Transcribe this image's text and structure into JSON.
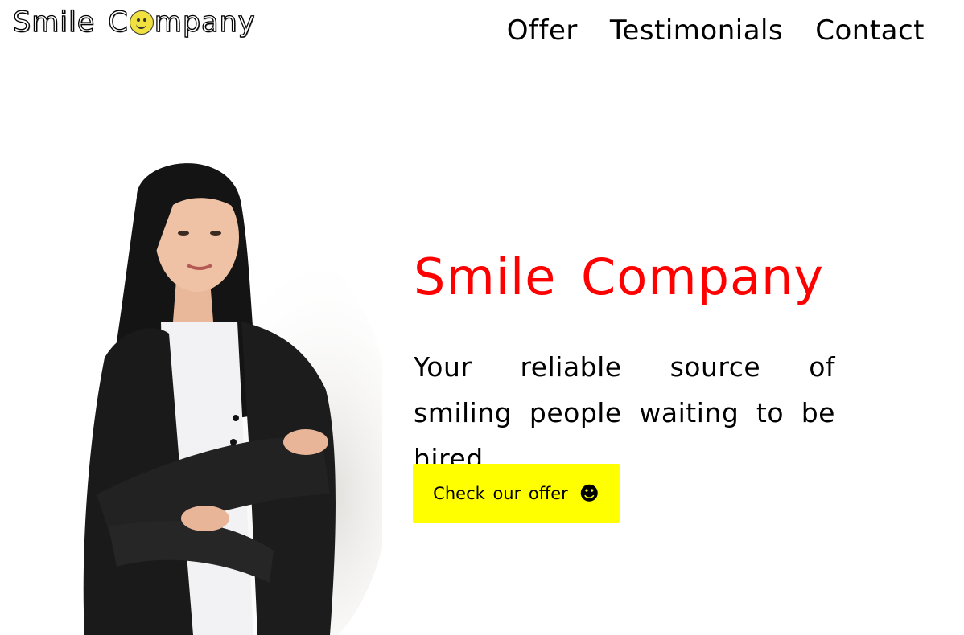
{
  "header": {
    "logo": {
      "word1": "Smile",
      "word2_pre": "C",
      "word2_post": "mpany",
      "icon": "smiley-face-icon"
    },
    "nav": [
      {
        "label": "Offer"
      },
      {
        "label": "Testimonials"
      },
      {
        "label": "Contact"
      }
    ]
  },
  "hero": {
    "title": "Smile Company",
    "subtitle": "Your reliable source of smiling people waiting to be hired.",
    "cta_label": "Check our offer",
    "cta_icon": "☻",
    "image_desc": "woman-in-black-blazer-photo"
  },
  "colors": {
    "title": "#ff0000",
    "cta_bg": "#ffff00",
    "background": "#ffffff"
  }
}
